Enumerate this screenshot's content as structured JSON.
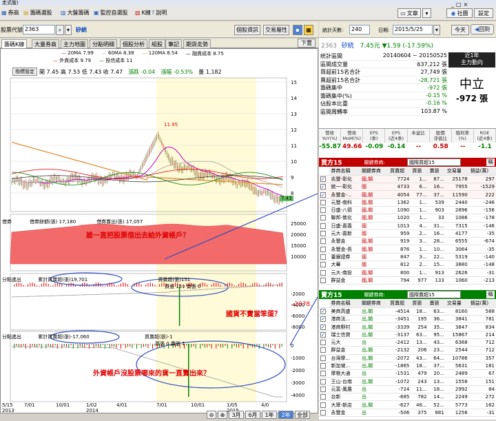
{
  "window": {
    "title": "走式版)"
  },
  "menu": {
    "items": [
      {
        "label": "券商",
        "icon": "chart-icon"
      },
      {
        "label": "籌碼選股",
        "icon": "folder-icon"
      },
      {
        "label": "大盤籌碼",
        "icon": "grid-icon"
      },
      {
        "label": "監控自選股",
        "icon": "monitor-icon"
      },
      {
        "label": "K線",
        "icon": "kline-icon"
      },
      {
        "label": "說明",
        "icon": "help-icon"
      }
    ],
    "right_buttons": [
      "文章",
      "社團",
      "設定"
    ],
    "window_controls": [
      "_",
      "□",
      "×"
    ]
  },
  "toolbar": {
    "code_label": "股票代號:",
    "code_value": "2363",
    "stock_name": "矽統",
    "btn_info": "個股資訊",
    "btn_attr": "交易屬性"
  },
  "right_toolbar": {
    "days_label": "統計天數:",
    "days_value": "240",
    "date_label": "日期:",
    "date_value": "2015/5/25",
    "today": "今天",
    "back": "回到"
  },
  "tabs": [
    "籌碼K線",
    "大量券商",
    "主力地圖",
    "分點明細",
    "個股分析",
    "組股",
    "筆記",
    "期貨走勢"
  ],
  "tab_right": "下置",
  "chart": {
    "legend1": [
      {
        "text": "20MA 7.99",
        "color": "#c000c0"
      },
      {
        "text": "60MA 8.38",
        "color": "#b0b0b0"
      },
      {
        "text": "120MA 8.54",
        "color": "#e08000"
      },
      {
        "text": "融資成本 8.75",
        "color": "#000000"
      }
    ],
    "legend2": [
      {
        "text": "外資成本 9.79",
        "color": "#e00000"
      },
      {
        "text": "投信成本 11",
        "color": "#008000"
      }
    ],
    "indicator_btn": "指標設定",
    "ohlc": "開 7.45  高 7.53  低 7.43  收 7.47",
    "change": "漲跌 -0.04",
    "pct": "漲幅 -0.53%",
    "volume": "量 1,182",
    "price_axis": [
      "15",
      "14",
      "13",
      "12",
      "11",
      "10",
      "9",
      "8"
    ],
    "high_label": "11.95",
    "last_label": "7.43",
    "p2": {
      "name": "借券",
      "l1": "借券餘額(張) 17,180",
      "l2": "借券賣出(張) 17,057",
      "axis": [
        "25000",
        "20000",
        "15000",
        "10000"
      ]
    },
    "p3": {
      "name": "分點進出",
      "l1": "累計買賣超(張)19,701",
      "l2": "買賣超(張)151",
      "l3": "買張 151 賣張 0",
      "axis": [
        "-2000",
        "-4000",
        "-6000",
        "-8000"
      ],
      "edge": "-2078."
    },
    "p4": {
      "name": "分點進出",
      "l1": "累計買賣超(張)-17,060",
      "l2": "買賣超(張)-1",
      "l3": "買張 0 賣張 1",
      "axis": [
        "0",
        "-1000",
        "-2000",
        "-3000",
        "-4000"
      ]
    },
    "xaxis": [
      "5/15\n2013",
      "7/01",
      "10/01",
      "1/02\n2014",
      "4/01",
      "7/01",
      "10/01",
      "1/05\n2015",
      "4/0"
    ],
    "zoom": [
      "3月",
      "6月",
      "1年",
      "2年",
      "全部"
    ],
    "annotations": {
      "a1": "誰一直把股票借出去給外資帳戶？",
      "a2": "國貨不賣當笨蛋？",
      "a3": "外資帳戶沒股票哪來的貨一直賣出來？"
    }
  },
  "info": {
    "code": "2363",
    "name": "矽統",
    "price": "7.45元",
    "change": "▼1.59 (-17.59%)",
    "rows": [
      [
        "統計區間",
        "20140604 ~ 20150525"
      ],
      [
        "區間成交量",
        "637,212 張"
      ],
      [
        "買超前15名合計",
        "27,749 張"
      ],
      [
        "賣超前15名合計",
        "-28,721 張"
      ],
      [
        "籌碼集中",
        "-972 張"
      ],
      [
        "籌碼集中(%)",
        "-0.15 %"
      ],
      [
        "佔股本比重",
        "-0.16 %"
      ],
      [
        "區間周轉率",
        "103.87 %"
      ]
    ],
    "box_title1": "近1年",
    "box_title2": "主力動向",
    "box_big": "中立",
    "box_val": "-972 張",
    "metric_heads": [
      "營收\nYoY(%)",
      "營收\nMoM(%)",
      "EPS\n(季)",
      "EPS\n(近4季)",
      "本益比",
      "股價\n淨值比",
      "殖利率\n(%)",
      "ROE\n(近4季)"
    ],
    "metric_vals": [
      "-55.87",
      "49.66",
      "-0.09",
      "-0.14",
      "--",
      "0.58",
      "--",
      "-1.1"
    ]
  },
  "buy": {
    "title": "買方15",
    "filter_label": "關鍵券商:",
    "filter_value": "國際買超15",
    "heads": [
      "券商名稱",
      "關鍵券商",
      "買賣超",
      "買張",
      "賣張",
      "交易量",
      "損益(萬)"
    ],
    "rows": [
      [
        "兆豐-彰化",
        "國,關",
        "7724",
        "1...",
        "87...",
        "25178",
        "297"
      ],
      [
        "統一-彰化",
        "國",
        "4733",
        "6...",
        "16...",
        "7955",
        "-1529"
      ],
      [
        "永豐金-...",
        "國,關",
        "4054",
        "77...",
        "37...",
        "11590",
        "222"
      ],
      [
        "元豐-南科",
        "國,關",
        "1362",
        "1...",
        "539",
        "2440",
        "-246"
      ],
      [
        "日盛-八德",
        "國,關",
        "1090",
        "1...",
        "903",
        "2896",
        "-156"
      ],
      [
        "聯邦-敦化",
        "國,關",
        "1020",
        "1...",
        "33",
        "1086",
        "-178"
      ],
      [
        "日盛-嘉義",
        "國",
        "1013",
        "4...",
        "31...",
        "7315",
        "-146"
      ],
      [
        "元大-嘉新",
        "國",
        "959",
        "2...",
        "16...",
        "4177",
        "-35"
      ],
      [
        "永豐金",
        "國,關",
        "919",
        "3...",
        "28...",
        "6555",
        "-674"
      ],
      [
        "永豐金-長",
        "國,關",
        "876",
        "1...",
        "10...",
        "3064",
        "-35"
      ],
      [
        "臺銀證券",
        "國",
        "847",
        "3...",
        "22...",
        "5319",
        "-140"
      ],
      [
        "大華",
        "國",
        "812",
        "2...",
        "15...",
        "3880",
        "-148"
      ],
      [
        "元大-南投",
        "國,關",
        "800",
        "1...",
        "913",
        "2626",
        "-31"
      ],
      [
        "群益金",
        "國,關",
        "794",
        "977",
        "133",
        "1060",
        "-213"
      ]
    ]
  },
  "sell": {
    "title": "賣方15",
    "filter_label": "關鍵券商:",
    "filter_value": "國際賣超15",
    "heads": [
      "券商名稱",
      "關鍵券商",
      "買賣超",
      "買張",
      "賣張",
      "交易量",
      "損益(萬)"
    ],
    "rows": [
      [
        "美商高盛",
        "出,關",
        "-4514",
        "18...",
        "63...",
        "8160",
        "588"
      ],
      [
        "港商法...",
        "出,關",
        "-3451",
        "195",
        "36...",
        "3841",
        "781"
      ],
      [
        "港商野村",
        "出,關",
        "-3339",
        "254",
        "35...",
        "3847",
        "834"
      ],
      [
        "瑞士信貸",
        "出,關",
        "-3137",
        "63...",
        "95...",
        "15867",
        "214"
      ],
      [
        "元大",
        "出",
        "-2412",
        "13...",
        "43...",
        "6368",
        "712"
      ],
      [
        "群益金",
        "出,關",
        "-2132",
        "206",
        "23...",
        "2544",
        "712"
      ],
      [
        "台灣摩...",
        "出,關",
        "-2072",
        "43...",
        "64...",
        "10786",
        "357"
      ],
      [
        "新加坡...",
        "出,關",
        "-1865",
        "18...",
        "37...",
        "5631",
        "181"
      ],
      [
        "摩根大通",
        "出",
        "-1531",
        "479",
        "20...",
        "2489",
        "67"
      ],
      [
        "王山-台南",
        "出,關",
        "-1072",
        "243",
        "13...",
        "1558",
        "151"
      ],
      [
        "元富-鳳農",
        "出",
        "-724",
        "11...",
        "18...",
        "2992",
        "84"
      ],
      [
        "台新",
        "出",
        "-685",
        "782",
        "14...",
        "2249",
        "272"
      ],
      [
        "大眾-新店",
        "出,關",
        "-627",
        "46...",
        "52...",
        "5773",
        "162"
      ],
      [
        "永豐金",
        "出",
        "-506",
        "375",
        "881",
        "1256",
        "-31"
      ]
    ]
  }
}
